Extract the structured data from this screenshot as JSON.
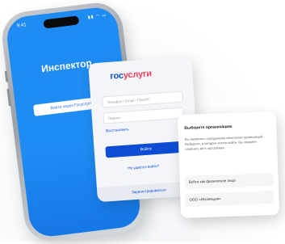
{
  "phone": {
    "status_time": "9:41",
    "status_icons": "▮▮ ◠ ▭",
    "app_title": "Инспектор",
    "login_button": "Войти через Госуслуги"
  },
  "gosuslugi": {
    "logo_part1": "гос",
    "logo_part2": "услуги",
    "login_placeholder": "Телефон / Email / СНИЛС",
    "password_placeholder": "Пароль",
    "restore_link": "Восстановить",
    "submit_button": "Войти",
    "other_way_link": "Не удаётся войти?",
    "footer_link": "Зарегистрироваться"
  },
  "card3": {
    "title": "Выберите организацию",
    "body": "Вы являетесь сотрудником нескольких организаций. Выберите, в которую хотите войти. Вы сможете изменить её в настройках.",
    "item1": "Войти как физическое лицо",
    "item2": "ООО «Инспекция»"
  },
  "colors": {
    "phone_screen": "#1f8cf3",
    "gos_blue": "#0d4cd3",
    "gos_red": "#ee3f58"
  }
}
